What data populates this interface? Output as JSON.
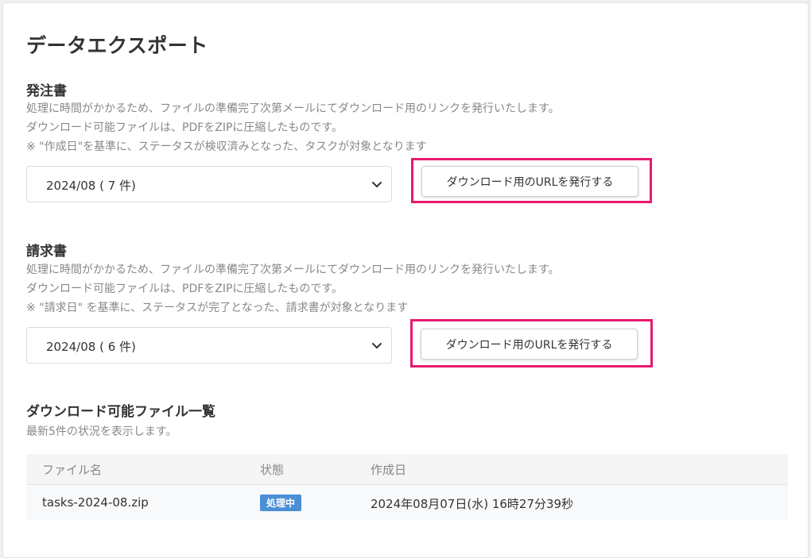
{
  "page": {
    "title": "データエクスポート"
  },
  "purchase_order": {
    "title": "発注書",
    "desc": [
      "処理に時間がかかるため、ファイルの準備完了次第メールにてダウンロード用のリンクを発行いたします。",
      "ダウンロード可能ファイルは、PDFをZIPに圧縮したものです。",
      "※ \"作成日\"を基準に、ステータスが検収済みとなった、タスクが対象となります"
    ],
    "select_value": "2024/08 ( 7 件)",
    "button_label": "ダウンロード用のURLを発行する"
  },
  "invoice": {
    "title": "請求書",
    "desc": [
      "処理に時間がかかるため、ファイルの準備完了次第メールにてダウンロード用のリンクを発行いたします。",
      "ダウンロード可能ファイルは、PDFをZIPに圧縮したものです。",
      "※ \"請求日\" を基準に、ステータスが完了となった、請求書が対象となります"
    ],
    "select_value": "2024/08 ( 6 件)",
    "button_label": "ダウンロード用のURLを発行する"
  },
  "files": {
    "title": "ダウンロード可能ファイル一覧",
    "subtitle": "最新5件の状況を表示します。",
    "columns": [
      "ファイル名",
      "状態",
      "作成日"
    ],
    "rows": [
      {
        "name": "tasks-2024-08.zip",
        "status": "処理中",
        "created": "2024年08月07日(水) 16時27分39秒"
      }
    ]
  },
  "colors": {
    "highlight": "#e8196f",
    "status_badge": "#4b8fd6"
  },
  "icons": {
    "select_arrow": "chevron-down-icon"
  }
}
